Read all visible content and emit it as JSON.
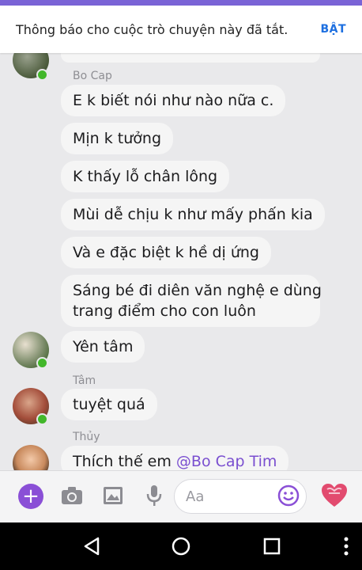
{
  "notice": {
    "text": "Thông báo cho cuộc trò chuyện này đã tắt.",
    "action": "BẬT"
  },
  "messages": [
    {
      "sender": "Bo Cap",
      "text": "E k biết nói như nào nữa c."
    },
    {
      "text": "Mịn k tưởng"
    },
    {
      "text": "K thấy lỗ chân lông"
    },
    {
      "text": "Mùi dễ chịu k như mấy phấn kia"
    },
    {
      "text": "Và e đặc biệt k hề dị ứng"
    },
    {
      "text_line1": "Sáng bé đi diên văn nghệ e dùng",
      "text_line2": "trang điểm cho con luôn"
    },
    {
      "text": "Yên tâm"
    },
    {
      "sender": "Tâm",
      "text": "tuyệt quá"
    },
    {
      "sender": "Thủy",
      "text": "Thích thế em",
      "mention": "@Bo Cap Tim"
    }
  ],
  "composer": {
    "placeholder": "Aa",
    "icons": [
      "plus-icon",
      "camera-icon",
      "image-icon",
      "mic-icon",
      "emoji-icon",
      "heart-icon"
    ]
  },
  "navigation": {
    "icons": [
      "back-icon",
      "home-icon",
      "recents-icon",
      "menu-icon"
    ]
  },
  "colors": {
    "accent": "#7a63d6",
    "link": "#1d6fe0",
    "online": "#42b72a",
    "mention": "#7a4fd0",
    "heart": "#e24b6f"
  }
}
